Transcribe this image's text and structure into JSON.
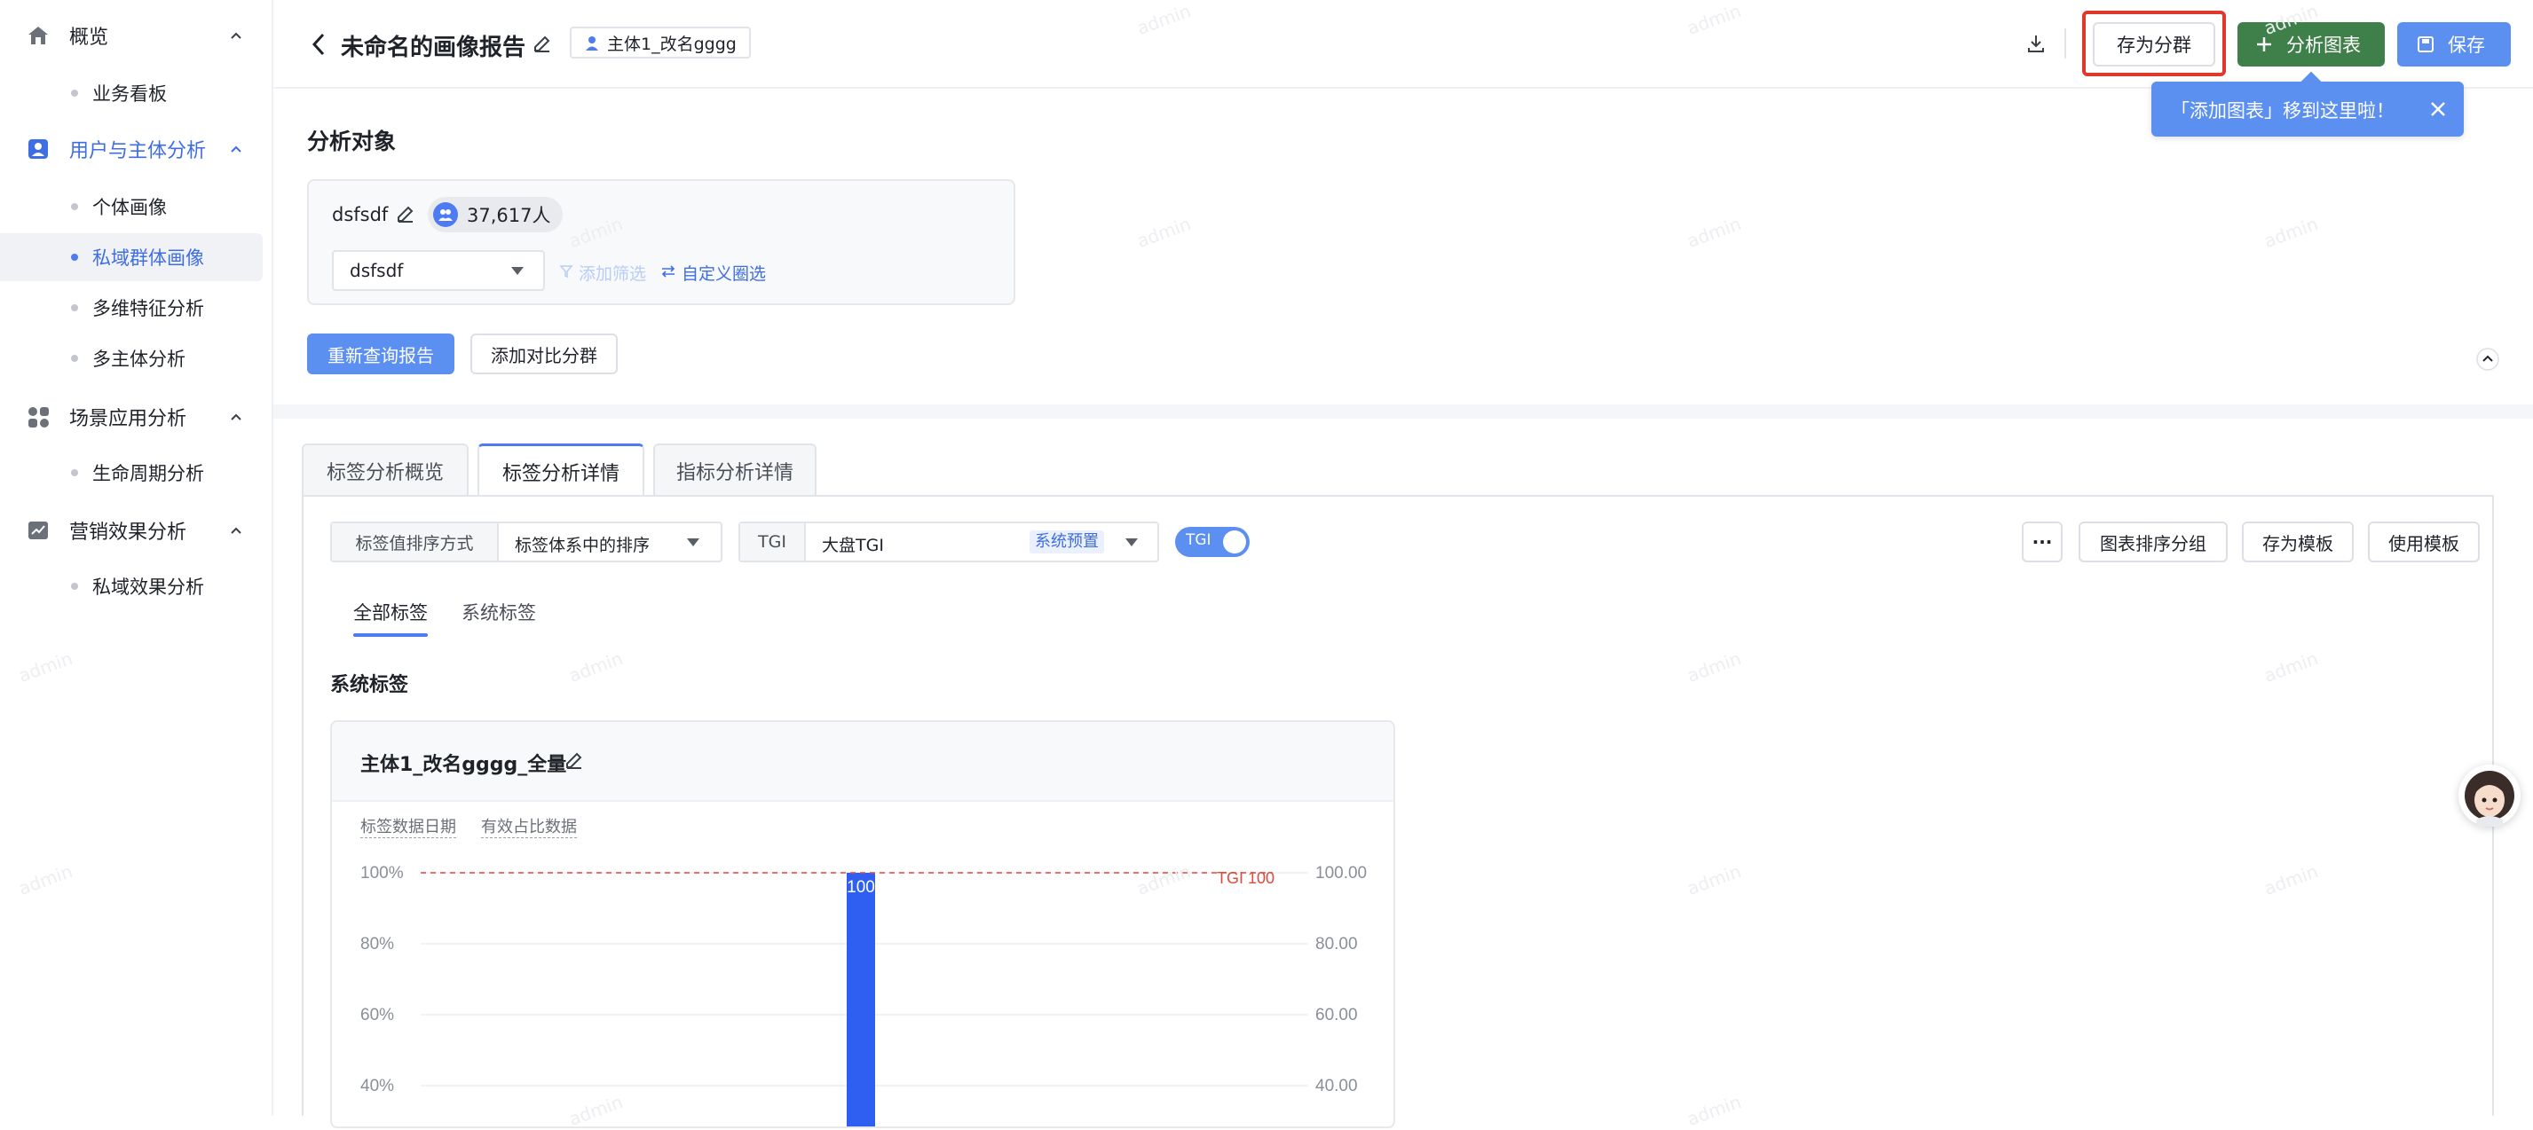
{
  "sidebar": {
    "groups": [
      {
        "label": "概览",
        "icon": "home-icon",
        "items": [
          {
            "label": "业务看板"
          }
        ]
      },
      {
        "label": "用户与主体分析",
        "icon": "user-card-icon",
        "items": [
          {
            "label": "个体画像"
          },
          {
            "label": "私域群体画像"
          },
          {
            "label": "多维特征分析"
          },
          {
            "label": "多主体分析"
          }
        ]
      },
      {
        "label": "场景应用分析",
        "icon": "grid-apps-icon",
        "items": [
          {
            "label": "生命周期分析"
          }
        ]
      },
      {
        "label": "营销效果分析",
        "icon": "trend-chart-icon",
        "items": [
          {
            "label": "私域效果分析"
          }
        ]
      }
    ]
  },
  "header": {
    "title": "未命名的画像报告",
    "subject_tag": "主体1_改名gggg",
    "save_segment_label": "存为分群",
    "add_chart_label": "分析图表",
    "save_label": "保存",
    "tooltip_text": "「添加图表」移到这里啦！"
  },
  "analysis": {
    "section_title": "分析对象",
    "segment_name": "dsfsdf",
    "people_count": "37,617人",
    "select_value": "dsfsdf",
    "add_filter_label": "添加筛选",
    "custom_select_label": "自定义圈选",
    "requery_label": "重新查询报告",
    "add_compare_label": "添加对比分群"
  },
  "tabs": [
    {
      "label": "标签分析概览"
    },
    {
      "label": "标签分析详情"
    },
    {
      "label": "指标分析详情"
    }
  ],
  "toolbar": {
    "sort_label": "标签值排序方式",
    "sort_value": "标签体系中的排序",
    "tgi_label": "TGI",
    "tgi_value": "大盘TGI",
    "tgi_badge": "系统预置",
    "toggle_label": "TGI",
    "more_label": "···",
    "chart_sort_label": "图表排序分组",
    "save_template_label": "存为模板",
    "use_template_label": "使用模板"
  },
  "subtabs": [
    {
      "label": "全部标签"
    },
    {
      "label": "系统标签"
    }
  ],
  "section": {
    "title": "系统标签"
  },
  "chart_card": {
    "title": "主体1_改名gggg_全量",
    "meta_date_label": "标签数据日期",
    "meta_ratio_label": "有效占比数据"
  },
  "chart_data": {
    "type": "bar",
    "left_ticks": [
      "100%",
      "80%",
      "60%",
      "40%"
    ],
    "right_ticks": [
      "100.00",
      "80.00",
      "60.00",
      "40.00"
    ],
    "values": [
      100
    ],
    "data_labels": [
      "100"
    ],
    "tgi_reference_label": "TGI 100",
    "tgi_reference_value": 100,
    "bar_color": "#2e5ff0",
    "reference_color": "#e04a3b"
  },
  "watermark_text": "admin",
  "colors": {
    "accent": "#4c7bf4",
    "green": "#3f7f4a",
    "highlight": "#e0392b"
  }
}
